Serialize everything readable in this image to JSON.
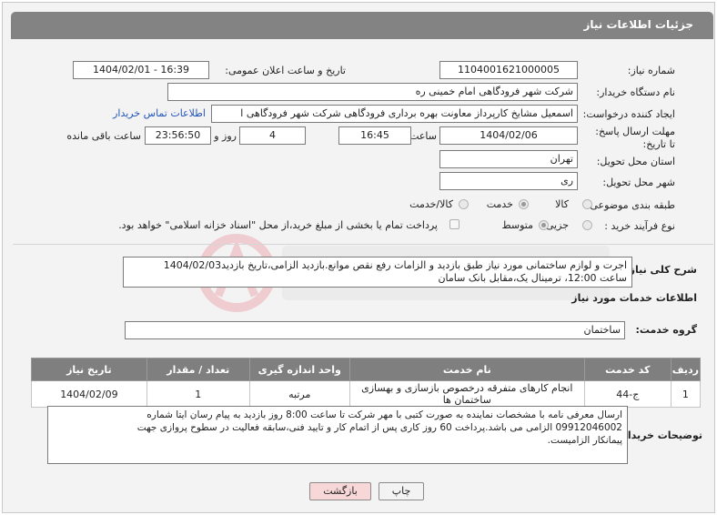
{
  "header": {
    "title": "جزئیات اطلاعات نیاز"
  },
  "form": {
    "need_number": {
      "label": "شماره نیاز:",
      "value": "1104001621000005"
    },
    "announce_datetime": {
      "label": "تاریخ و ساعت اعلان عمومی:",
      "value": "1404/02/01 - 16:39"
    },
    "buyer_org": {
      "label": "نام دستگاه خریدار:",
      "value": "شرکت شهر فرودگاهی امام خمینی  ره"
    },
    "creator": {
      "label": "ایجاد کننده درخواست:",
      "value": "اسمعیل مشایخ کارپرداز معاونت بهره برداری فرودگاهی شرکت شهر فرودگاهی ا",
      "contact_link": "اطلاعات تماس خریدار"
    },
    "deadline": {
      "label": "مهلت ارسال پاسخ: تا تاریخ:",
      "date": "1404/02/06",
      "time_label": "ساعت",
      "time": "16:45",
      "days": "4",
      "days_label": "روز و",
      "remaining": "23:56:50",
      "remaining_label": "ساعت باقی مانده"
    },
    "province": {
      "label": "استان محل تحویل:",
      "value": "تهران"
    },
    "city": {
      "label": "شهر محل تحویل:",
      "value": "ری"
    },
    "category": {
      "label": "طبقه بندی موضوعی:",
      "options": [
        "کالا",
        "خدمت",
        "کالا/خدمت"
      ],
      "selected": "خدمت"
    },
    "purchase_type": {
      "label": "نوع فرآیند خرید :",
      "options": [
        "جزیی",
        "متوسط"
      ],
      "selected": "متوسط",
      "note": "پرداخت تمام یا بخشی از مبلغ خرید،از محل \"اسناد خزانه اسلامی\" خواهد بود."
    }
  },
  "summary": {
    "label": "شرح کلی نیاز:",
    "line1": "اجرت و لوازم ساختمانی مورد نیاز طبق بازدید و الزامات رفع نقص موانع.بازدید الزامی،تاریخ بازدید1404/02/03",
    "line2": "ساعت 12:00، ترمینال یک،مقابل بانک سامان"
  },
  "services": {
    "title": "اطلاعات خدمات مورد نیاز",
    "group_label": "گروه خدمت:",
    "group_value": "ساختمان",
    "columns": [
      "ردیف",
      "کد خدمت",
      "نام خدمت",
      "واحد اندازه گیری",
      "تعداد / مقدار",
      "تاریخ نیاز"
    ],
    "rows": [
      {
        "row": "1",
        "code": "ج-44",
        "name": "انجام کارهای متفرقه درخصوص بازسازی و بهسازی ساختمان ها",
        "unit": "مرتبه",
        "qty": "1",
        "date": "1404/02/09"
      }
    ]
  },
  "buyer_notes": {
    "label": "توضیحات خریدار:",
    "line1": "ارسال معرفی نامه با مشخصات نماینده به صورت کتبی با مهر شرکت تا ساعت 8:00 روز بازدید به پیام رسان ایتا شماره",
    "line2": "09912046002 الزامی می باشد.پرداخت 60 روز کاری پس از اتمام کار و تایید فنی،سابقه فعالیت در سطوح پروازی جهت",
    "line3": "پیمانکار الزامیست."
  },
  "buttons": {
    "print": "چاپ",
    "back": "بازگشت"
  },
  "colors": {
    "header": "#838383",
    "back_button": "#f7d7d7",
    "link": "#2255bb"
  }
}
